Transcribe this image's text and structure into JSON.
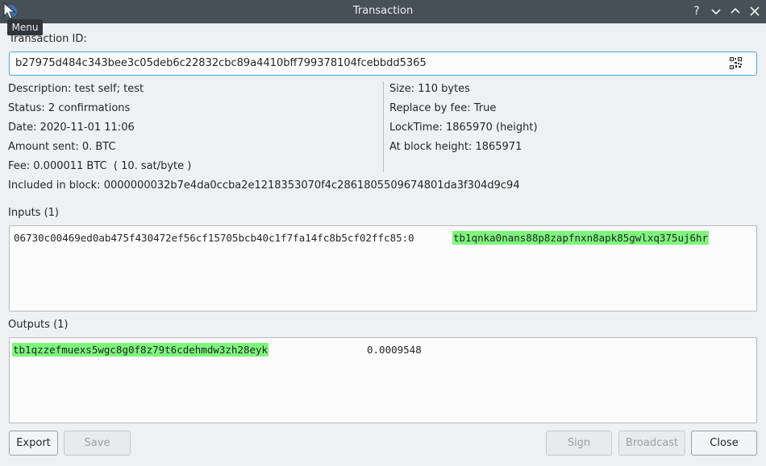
{
  "window": {
    "title": "Transaction",
    "tooltip": "Menu",
    "help_glyph": "?",
    "minimize_glyph": "⌄",
    "maximize_glyph": "⌃",
    "close_glyph": "✕"
  },
  "txid": {
    "label": "Transaction ID:",
    "value": "b27975d484c343bee3c05deb6c22832cbc89a4410bff799378104fcebbdd5365"
  },
  "details_left": {
    "description": "Description: test self; test",
    "status": "Status: 2 confirmations",
    "date": "Date: 2020-11-01 11:06",
    "amount_sent": "Amount sent: 0. BTC",
    "fee": "Fee: 0.000011 BTC  ( 10. sat/byte )"
  },
  "details_right": {
    "size": "Size: 110 bytes",
    "rbf": "Replace by fee: True",
    "locktime": "LockTime: 1865970 (height)",
    "block_height": "At block height: 1865971"
  },
  "included_in_block": "Included in block: 0000000032b7e4da0ccba2e1218353070f4c2861805509674801da3f304d9c94",
  "inputs": {
    "label": "Inputs (1)",
    "items": [
      {
        "outpoint": "06730c00469ed0ab475f430472ef56cf15705bcb40c1f7fa14fc8b5cf02ffc85:0",
        "address": "tb1qnka0nans88p8zapfnxn8apk85gwlxq375uj6hr"
      }
    ]
  },
  "outputs": {
    "label": "Outputs (1)",
    "items": [
      {
        "address": "tb1qzzefmuexs5wgc8g0f8z79t6cdehmdw3zh28eyk",
        "amount": "0.0009548"
      }
    ]
  },
  "buttons": {
    "export": "Export",
    "save": "Save",
    "sign": "Sign",
    "broadcast": "Broadcast",
    "close": "Close"
  },
  "colors": {
    "accent": "#3daee9",
    "address_highlight": "#7df57b",
    "titlebar": "#475057"
  }
}
